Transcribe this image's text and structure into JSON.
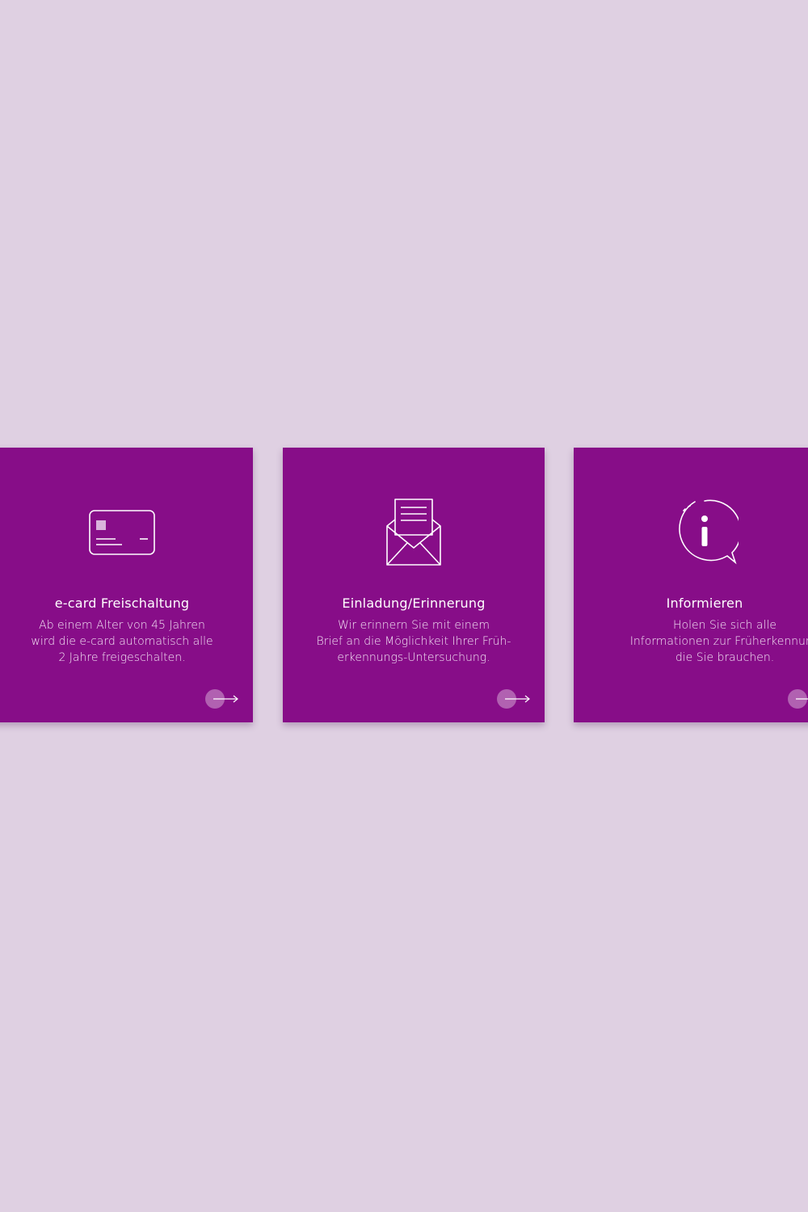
{
  "colors": {
    "background": "#dfd0e2",
    "card": "#870d88",
    "text": "#ffffff"
  },
  "cards": [
    {
      "icon": "credit-card-icon",
      "title": "e-card Freischaltung",
      "text": "Ab einem Alter von 45 Jahren\nwird die e-card automatisch alle\n2 Jahre freigeschalten."
    },
    {
      "icon": "envelope-letter-icon",
      "title": "Einladung/Erinnerung",
      "text": "Wir erinnern Sie mit einem\nBrief an die Möglichkeit Ihrer Früh-\nerkennungs-Untersuchung."
    },
    {
      "icon": "info-speech-bubble-icon",
      "title": "Informieren",
      "text": "Holen Sie sich alle\nInformationen zur Früherkennung\ndie Sie brauchen."
    }
  ]
}
